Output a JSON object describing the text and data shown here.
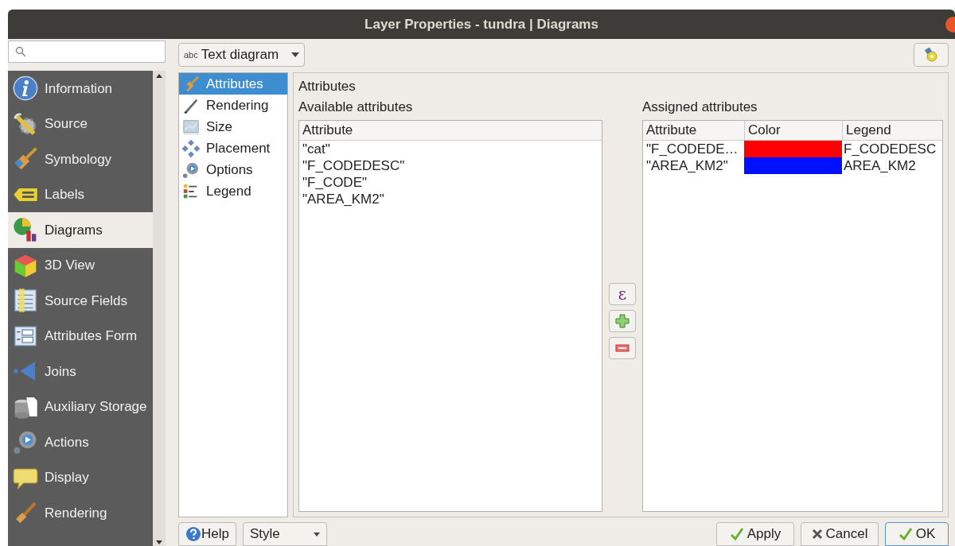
{
  "window": {
    "title": "Layer Properties - tundra | Diagrams"
  },
  "sidebar": {
    "items": [
      {
        "label": "Information",
        "selected": false
      },
      {
        "label": "Source",
        "selected": false
      },
      {
        "label": "Symbology",
        "selected": false
      },
      {
        "label": "Labels",
        "selected": false
      },
      {
        "label": "Diagrams",
        "selected": true
      },
      {
        "label": "3D View",
        "selected": false
      },
      {
        "label": "Source Fields",
        "selected": false
      },
      {
        "label": "Attributes Form",
        "selected": false
      },
      {
        "label": "Joins",
        "selected": false
      },
      {
        "label": "Auxiliary Storage",
        "selected": false
      },
      {
        "label": "Actions",
        "selected": false
      },
      {
        "label": "Display",
        "selected": false
      },
      {
        "label": "Rendering",
        "selected": false
      }
    ]
  },
  "diagram_type": {
    "prefix": "abc",
    "value": "Text diagram"
  },
  "sections": [
    {
      "label": "Attributes",
      "selected": true
    },
    {
      "label": "Rendering",
      "selected": false
    },
    {
      "label": "Size",
      "selected": false
    },
    {
      "label": "Placement",
      "selected": false
    },
    {
      "label": "Options",
      "selected": false
    },
    {
      "label": "Legend",
      "selected": false
    }
  ],
  "panel": {
    "title": "Attributes",
    "available": {
      "title": "Available attributes",
      "column": "Attribute",
      "rows": [
        "\"cat\"",
        "\"F_CODEDESC\"",
        "\"F_CODE\"",
        "\"AREA_KM2\""
      ]
    },
    "middle_buttons": [
      {
        "kind": "expression",
        "label": "ε"
      },
      {
        "kind": "add"
      },
      {
        "kind": "remove"
      }
    ],
    "assigned": {
      "title": "Assigned attributes",
      "columns": [
        "Attribute",
        "Color",
        "Legend"
      ],
      "rows": [
        {
          "attribute": "\"F_CODEDE…",
          "color": "#ff0000",
          "legend": "F_CODEDESC"
        },
        {
          "attribute": "\"AREA_KM2\"",
          "color": "#0010ff",
          "legend": "AREA_KM2"
        }
      ]
    }
  },
  "buttons": {
    "help": "Help",
    "style": "Style",
    "apply": "Apply",
    "cancel": "Cancel",
    "ok": "OK"
  }
}
